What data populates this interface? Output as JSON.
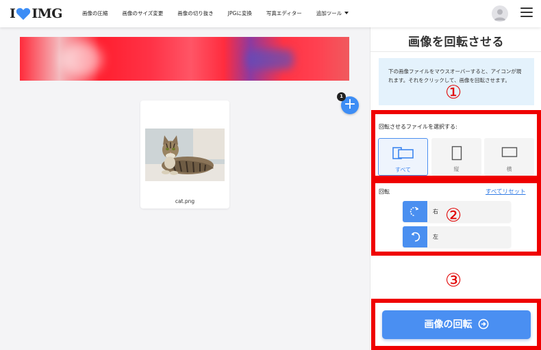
{
  "header": {
    "logo_left": "I",
    "logo_right": "IMG",
    "nav": [
      {
        "label": "画像の圧縮"
      },
      {
        "label": "画像のサイズ変更"
      },
      {
        "label": "画像の切り抜き"
      },
      {
        "label": "JPGに変換"
      },
      {
        "label": "写真エディター"
      },
      {
        "label": "追加ツール"
      }
    ]
  },
  "workspace": {
    "add_badge": "1",
    "file": {
      "name": "cat.png"
    }
  },
  "sidebar": {
    "title": "画像を回転させる",
    "info": "下の画像ファイルをマウスオーバーすると、アイコンが現れます。それをクリックして、画像を回転させます。",
    "select_label": "回転させるファイルを選択する:",
    "options": [
      {
        "label": "すべて",
        "icon": "all-pages-icon",
        "active": true
      },
      {
        "label": "縦",
        "icon": "portrait-icon",
        "active": false
      },
      {
        "label": "横",
        "icon": "landscape-icon",
        "active": false
      }
    ],
    "rotate_label": "回転",
    "reset_label": "すべてリセット",
    "rotate_right": "右",
    "rotate_left": "左",
    "submit": "画像の回転"
  },
  "annotations": {
    "one": "①",
    "two": "②",
    "three": "③"
  },
  "colors": {
    "accent": "#4a8ff2",
    "annotation_red": "#ef0000",
    "logo_heart": "#3d8df5"
  }
}
